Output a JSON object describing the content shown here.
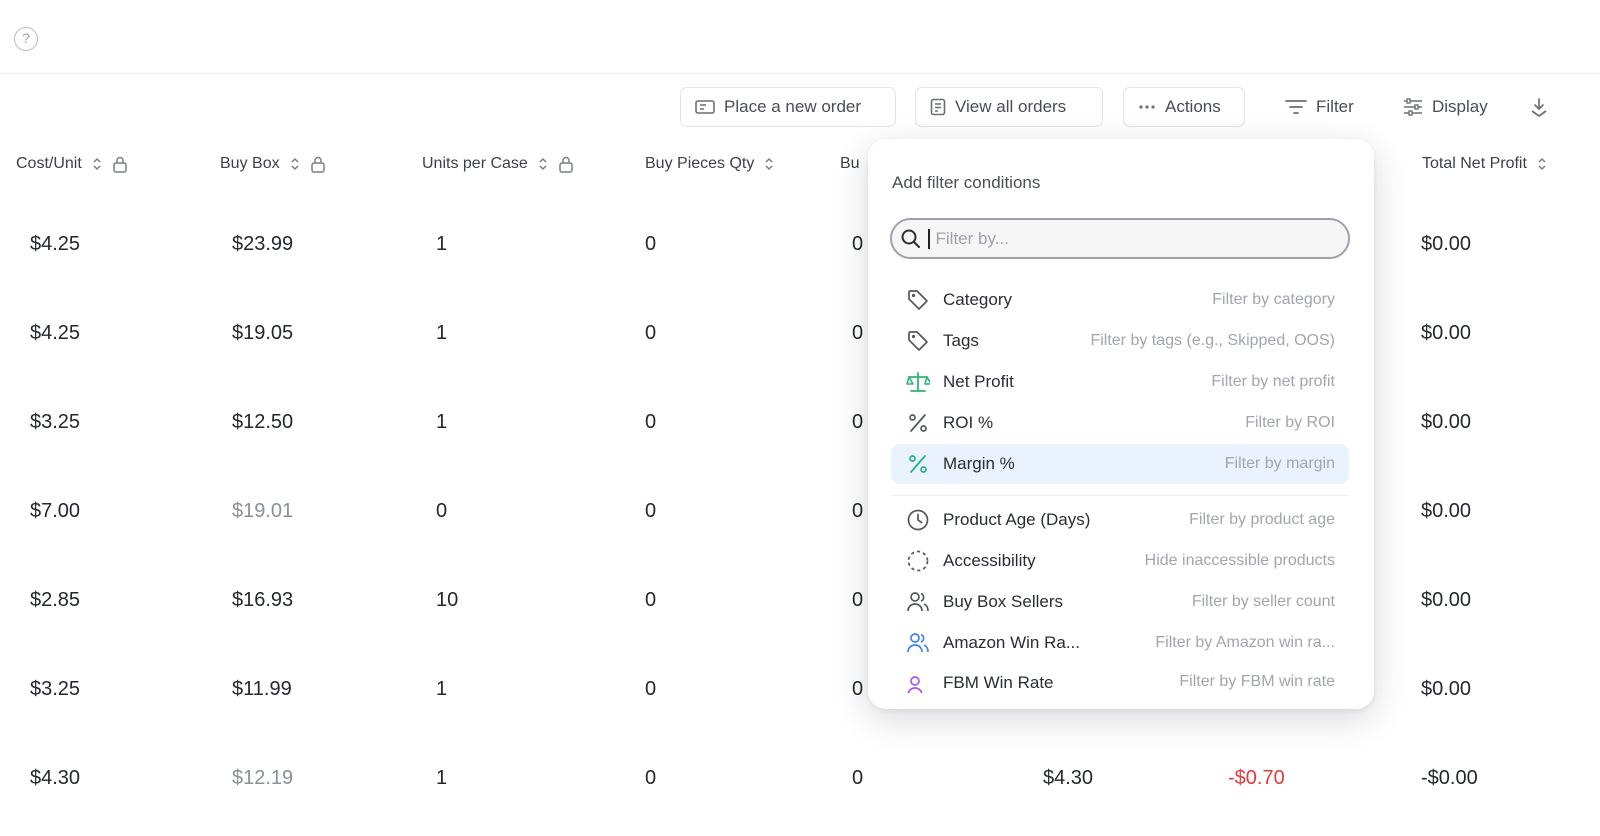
{
  "toolbar": {
    "place_order": "Place a new order",
    "view_orders": "View all orders",
    "actions": "Actions",
    "filter": "Filter",
    "display": "Display"
  },
  "columns": [
    {
      "label": "Cost/Unit",
      "sortable": true,
      "locked": true
    },
    {
      "label": "Buy Box",
      "sortable": true,
      "locked": true
    },
    {
      "label": "Units per Case",
      "sortable": true,
      "locked": true
    },
    {
      "label": "Buy Pieces Qty",
      "sortable": true,
      "locked": false
    },
    {
      "label": "Bu",
      "sortable": false,
      "locked": false
    },
    {
      "label": "Total Net Profit",
      "sortable": true,
      "locked": false
    }
  ],
  "rows": [
    {
      "cost": "$4.25",
      "buybox": "$23.99",
      "buybox_muted": false,
      "units": "1",
      "pieces": "0",
      "bu": "0",
      "extra1": "",
      "extra2": "",
      "total": "$0.00"
    },
    {
      "cost": "$4.25",
      "buybox": "$19.05",
      "buybox_muted": false,
      "units": "1",
      "pieces": "0",
      "bu": "0",
      "extra1": "",
      "extra2": "",
      "total": "$0.00"
    },
    {
      "cost": "$3.25",
      "buybox": "$12.50",
      "buybox_muted": false,
      "units": "1",
      "pieces": "0",
      "bu": "0",
      "extra1": "",
      "extra2": "",
      "total": "$0.00"
    },
    {
      "cost": "$7.00",
      "buybox": "$19.01",
      "buybox_muted": true,
      "units": "0",
      "pieces": "0",
      "bu": "0",
      "extra1": "",
      "extra2": "",
      "total": "$0.00"
    },
    {
      "cost": "$2.85",
      "buybox": "$16.93",
      "buybox_muted": false,
      "units": "10",
      "pieces": "0",
      "bu": "0",
      "extra1": "",
      "extra2": "",
      "total": "$0.00"
    },
    {
      "cost": "$3.25",
      "buybox": "$11.99",
      "buybox_muted": false,
      "units": "1",
      "pieces": "0",
      "bu": "0",
      "extra1": "",
      "extra2": "",
      "total": "$0.00"
    },
    {
      "cost": "$4.30",
      "buybox": "$12.19",
      "buybox_muted": true,
      "units": "1",
      "pieces": "0",
      "bu": "0",
      "extra1": "$4.30",
      "extra2": "-$0.70",
      "total": "-$0.00"
    }
  ],
  "filter_popover": {
    "title": "Add filter conditions",
    "search_placeholder": "Filter by...",
    "options": [
      {
        "icon": "tag-icon",
        "label": "Category",
        "desc": "Filter by category"
      },
      {
        "icon": "tag-icon",
        "label": "Tags",
        "desc": "Filter by tags (e.g., Skipped, OOS)"
      },
      {
        "icon": "scale-icon",
        "label": "Net Profit",
        "desc": "Filter by net profit"
      },
      {
        "icon": "percent-icon",
        "label": "ROI %",
        "desc": "Filter by ROI"
      },
      {
        "icon": "percent-icon",
        "label": "Margin %",
        "desc": "Filter by margin",
        "active": true
      },
      {
        "icon": "clock-icon",
        "label": "Product Age (Days)",
        "desc": "Filter by product age"
      },
      {
        "icon": "dashed-circle-icon",
        "label": "Accessibility",
        "desc": "Hide inaccessible products"
      },
      {
        "icon": "users-icon",
        "label": "Buy Box Sellers",
        "desc": "Filter by seller count"
      },
      {
        "icon": "users-blue-icon",
        "label": "Amazon Win Ra...",
        "desc": "Filter by Amazon win ra..."
      },
      {
        "icon": "users-purple-icon",
        "label": "FBM Win Rate",
        "desc": "Filter by FBM win rate"
      }
    ]
  },
  "colors": {
    "accent_green": "#2fb574",
    "accent_teal": "#21b38a",
    "accent_blue": "#3b82f6",
    "accent_purple": "#a855f7",
    "negative": "#e03b3b",
    "active_row": "#eaf3fd"
  }
}
